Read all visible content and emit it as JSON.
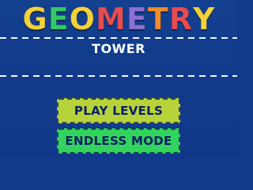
{
  "title": {
    "letters": [
      {
        "char": "G",
        "color": "#f3d13b"
      },
      {
        "char": "E",
        "color": "#35c86a"
      },
      {
        "char": "O",
        "color": "#f3d13b"
      },
      {
        "char": "M",
        "color": "#e64c52"
      },
      {
        "char": "E",
        "color": "#8b6fd6"
      },
      {
        "char": "T",
        "color": "#f08c2a"
      },
      {
        "char": "R",
        "color": "#e64c52"
      },
      {
        "char": "Y",
        "color": "#f3d13b"
      }
    ]
  },
  "subtitle": "TOWER",
  "buttons": {
    "play_levels": "PLAY LEVELS",
    "endless_mode": "ENDLESS MODE"
  },
  "colors": {
    "background": "#123a8c",
    "play_button": "#b7d33a",
    "endless_button": "#33d45e",
    "button_text": "#0c1f63"
  }
}
